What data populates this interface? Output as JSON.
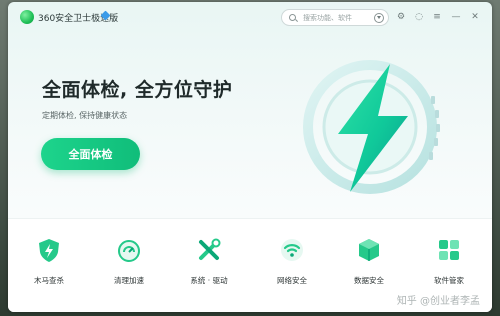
{
  "app": {
    "title": "360安全卫士极速版"
  },
  "search": {
    "placeholder": "搜索功能、软件"
  },
  "hero": {
    "headline": "全面体检, 全方位守护",
    "subtitle": "定期体检, 保持健康状态",
    "cta_label": "全面体检"
  },
  "features": [
    {
      "label": "木马查杀",
      "icon": "shield-virus-icon"
    },
    {
      "label": "清理加速",
      "icon": "cleanup-speed-icon"
    },
    {
      "label": "系统 · 驱动",
      "icon": "tools-icon"
    },
    {
      "label": "网络安全",
      "icon": "wifi-icon"
    },
    {
      "label": "数据安全",
      "icon": "data-cube-icon"
    },
    {
      "label": "软件管家",
      "icon": "apps-icon"
    }
  ],
  "watermark": "知乎 @创业者李孟",
  "colors": {
    "accent": "#14c97f",
    "background": "#eef7f6"
  }
}
